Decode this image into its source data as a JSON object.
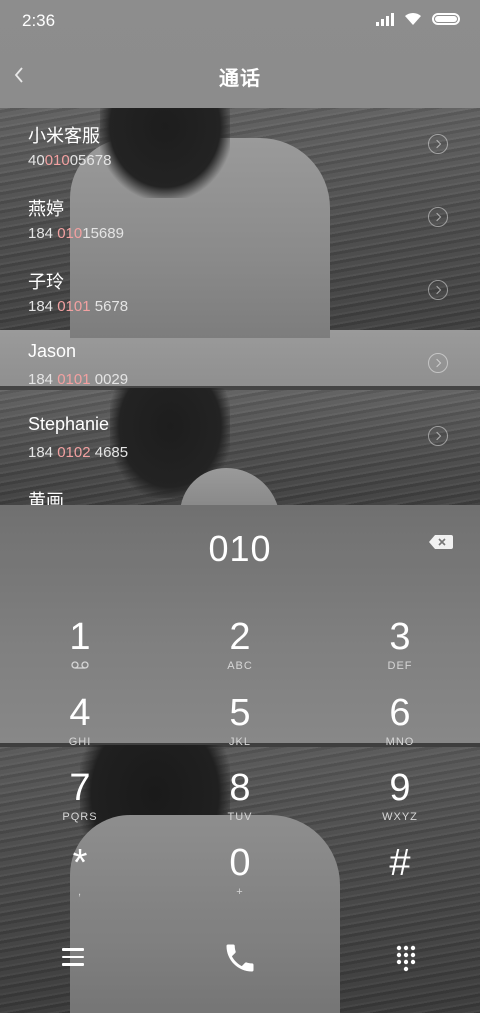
{
  "status_bar": {
    "time": "2:36",
    "icons": [
      "signal-icon",
      "wifi-icon",
      "battery-icon"
    ]
  },
  "header": {
    "title": "通话",
    "back_icon": "chevron-left-icon"
  },
  "contacts": [
    {
      "name": "小米客服",
      "number_pre": "40",
      "number_match": "010",
      "number_post": "05678"
    },
    {
      "name": "燕婷",
      "number_pre": "184 ",
      "number_match": "010",
      "number_post": "15689"
    },
    {
      "name": "子玲",
      "number_pre": "184 ",
      "number_match": "0101",
      "number_post": " 5678"
    },
    {
      "name": "Jason",
      "number_pre": "184 ",
      "number_match": "0101",
      "number_post": " 0029"
    },
    {
      "name": "Stephanie",
      "number_pre": "184 ",
      "number_match": "0102",
      "number_post": " 4685"
    },
    {
      "name": "黄画",
      "number_pre": "",
      "number_match": "",
      "number_post": ""
    }
  ],
  "dialer": {
    "number": "010",
    "backspace_icon": "backspace-icon"
  },
  "keypad": [
    {
      "digit": "1",
      "letters": "",
      "sub_icon": "voicemail-icon"
    },
    {
      "digit": "2",
      "letters": "ABC"
    },
    {
      "digit": "3",
      "letters": "DEF"
    },
    {
      "digit": "4",
      "letters": "GHI"
    },
    {
      "digit": "5",
      "letters": "JKL"
    },
    {
      "digit": "6",
      "letters": "MNO"
    },
    {
      "digit": "7",
      "letters": "PQRS"
    },
    {
      "digit": "8",
      "letters": "TUV"
    },
    {
      "digit": "9",
      "letters": "WXYZ"
    },
    {
      "digit": "*",
      "letters": ","
    },
    {
      "digit": "0",
      "letters": "+"
    },
    {
      "digit": "#",
      "letters": ""
    }
  ],
  "bottom_bar": {
    "menu_icon": "menu-icon",
    "call_icon": "phone-icon",
    "keypad_icon": "dialpad-icon"
  },
  "colors": {
    "match_highlight": "#f2a1a1",
    "text": "#ffffff"
  }
}
